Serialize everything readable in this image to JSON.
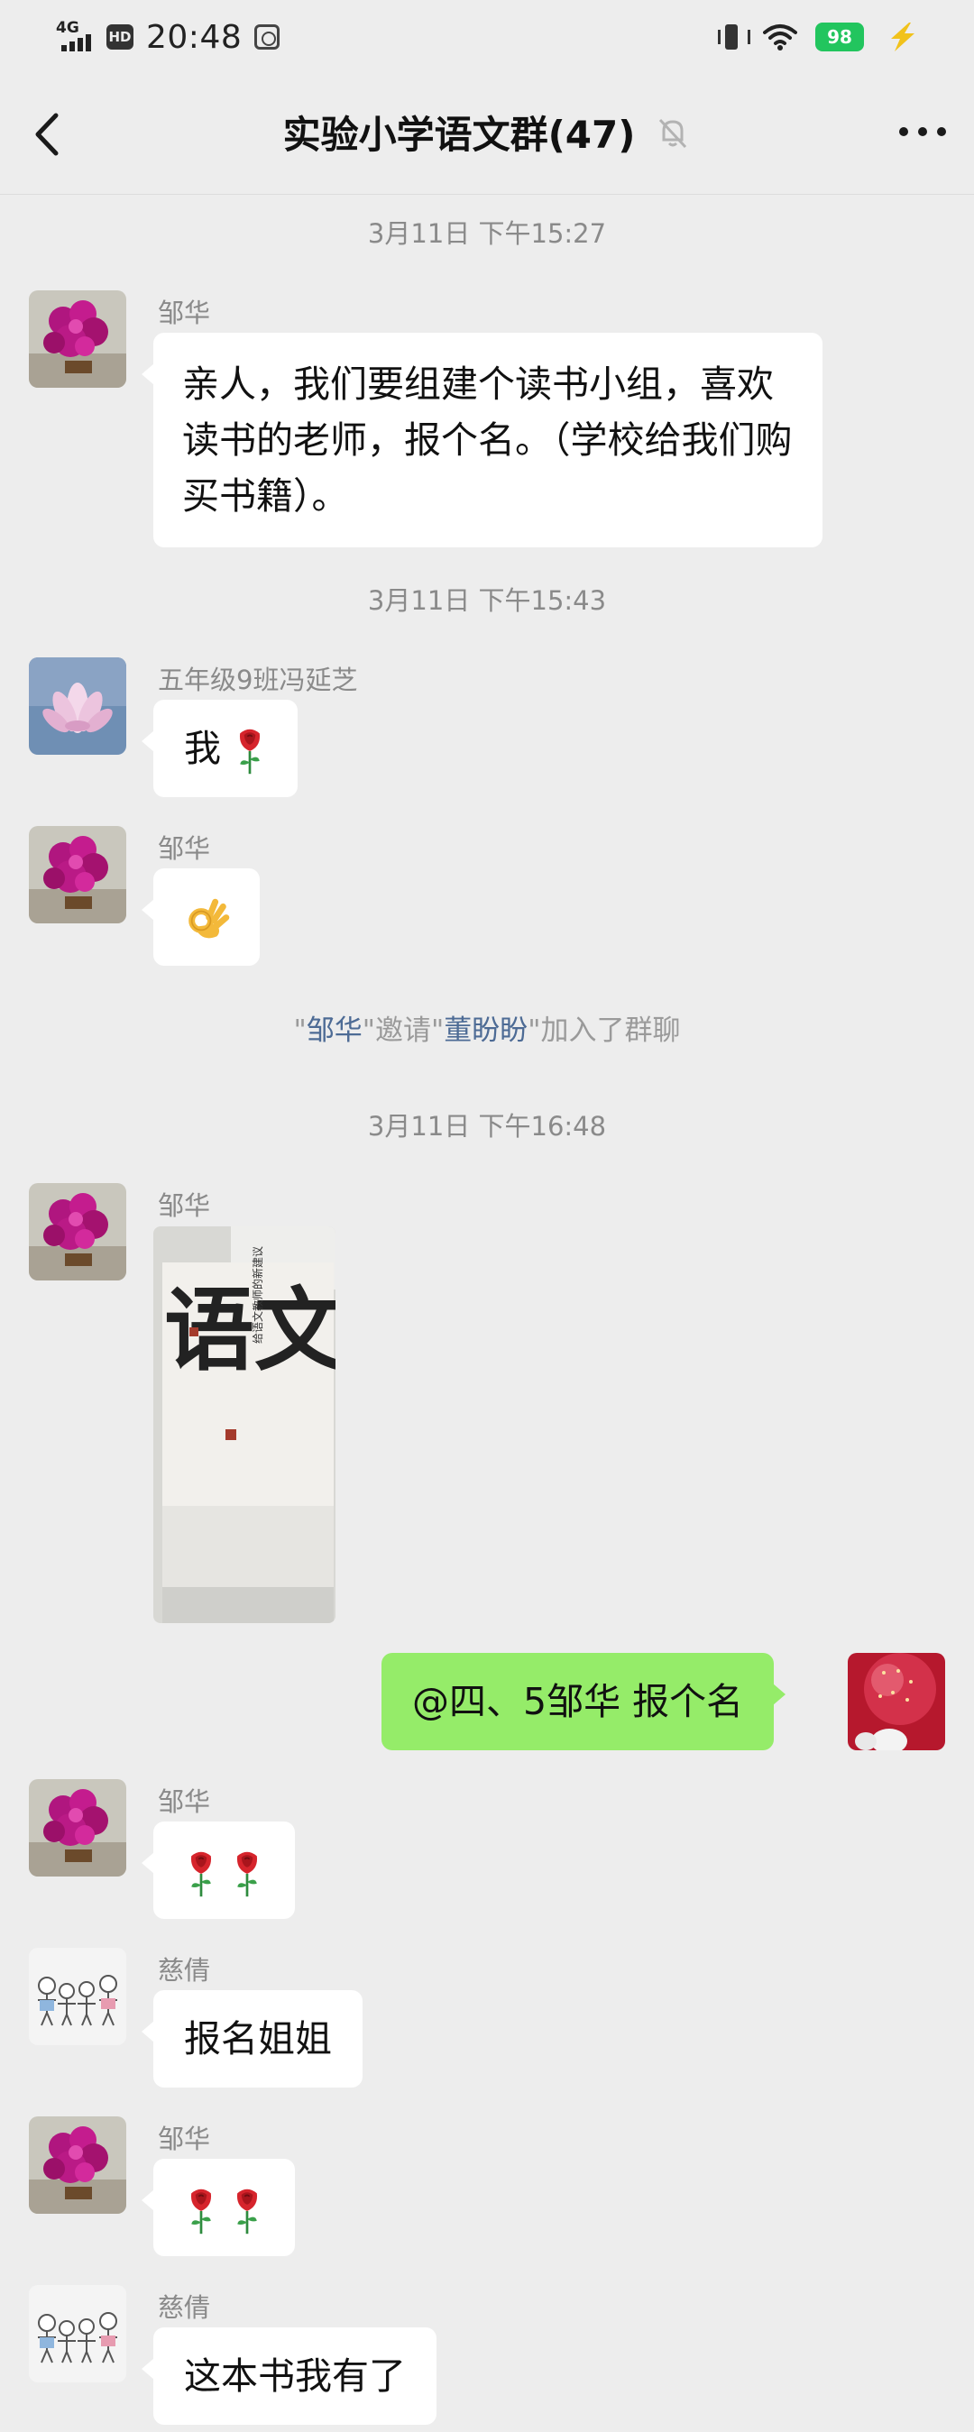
{
  "status_bar": {
    "network": "4G",
    "hd": "HD",
    "time": "20:48",
    "battery": "98"
  },
  "header": {
    "title": "实验小学语文群(47)"
  },
  "messages": {
    "ts1": "3月11日 下午15:27",
    "m1_sender": "邹华",
    "m1_text": "亲人，我们要组建个读书小组，喜欢读书的老师，报个名。（学校给我们购买书籍）。",
    "ts2": "3月11日 下午15:43",
    "m2_sender": "五年级9班冯延芝",
    "m2_text": "我",
    "m3_sender": "邹华",
    "sys_q1": "\"",
    "sys_inviter": "邹华",
    "sys_mid": "\"邀请\"",
    "sys_invitee": "董盼盼",
    "sys_end": "\"加入了群聊",
    "ts3": "3月11日 下午16:48",
    "m4_sender": "邹华",
    "m4_photo_text_big": "语文",
    "m4_photo_text_small": "给语文教师的新建议",
    "m5_text": "@四、5邹华  报个名",
    "m6_sender": "邹华",
    "m7_sender": "慈倩",
    "m7_text": "报名姐姐",
    "m8_sender": "邹华",
    "m9_sender": "慈倩",
    "m9_text": "这本书我有了"
  },
  "icons": {
    "back": "back-arrow-icon",
    "mute": "mute-bell-icon",
    "more": "more-dots-icon",
    "rose": "rose-emoji",
    "ok": "ok-hand-emoji"
  },
  "colors": {
    "background": "#ededed",
    "bubble_other": "#ffffff",
    "bubble_self": "#95ec69",
    "name_link": "#4d6b95",
    "battery": "#22c55e"
  }
}
